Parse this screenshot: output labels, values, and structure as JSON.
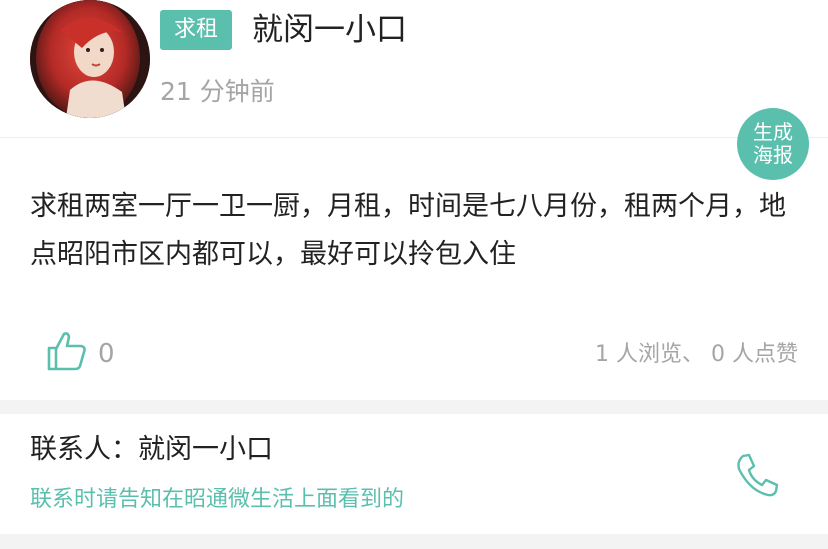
{
  "post": {
    "tag": "求租",
    "author_name": "就闵一小口",
    "time_ago": "21 分钟前",
    "poster_button": {
      "line1": "生成",
      "line2": "海报"
    },
    "content": "求租两室一厅一卫一厨，月租，时间是七八月份，租两个月，地点昭阳市区内都可以，最好可以拎包入住",
    "like_count": "0",
    "stats": "1 人浏览、 0 人点赞"
  },
  "contact": {
    "label": "联系人：就闵一小口",
    "tip": "联系时请告知在昭通微生活上面看到的"
  },
  "colors": {
    "accent": "#5bbfae",
    "muted": "#a5a5a5",
    "text": "#222222",
    "gap": "#f3f3f3"
  },
  "icons": {
    "avatar": "user-avatar",
    "like": "thumbs-up-icon",
    "phone": "phone-icon"
  }
}
